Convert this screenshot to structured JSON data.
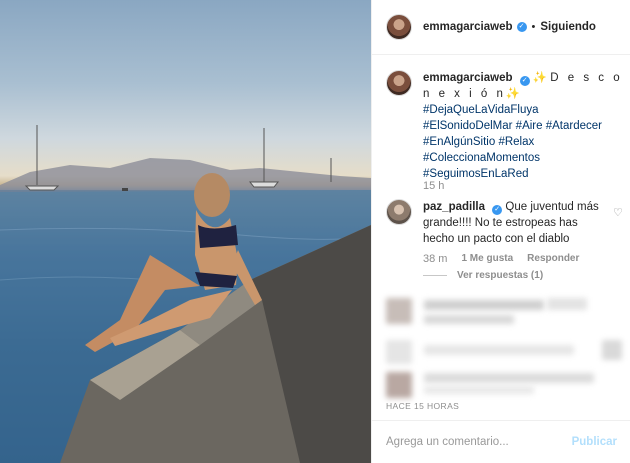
{
  "post": {
    "username": "emmagarciaweb",
    "follow_status": "Siguiendo",
    "separator": "•",
    "caption_desc": "✨D e s c o n e x i ó n✨",
    "hashtags": [
      "#DejaQueLaVidaFluya",
      "#ElSonidoDelMar #Aire #Atardecer",
      "#EnAlgúnSitio #Relax",
      "#ColeccionaMomentos",
      "#SeguimosEnLaRed"
    ],
    "caption_time": "15 h"
  },
  "comment": {
    "username": "paz_padilla",
    "text": "Que juventud más grande!!!! No te estropeas has hecho un pacto con el diablo",
    "time": "38 m",
    "likes": "1 Me gusta",
    "reply": "Responder",
    "view_replies": "Ver respuestas (1)"
  },
  "footer": {
    "posted": "HACE 15 HORAS",
    "comment_placeholder": "Agrega un comentario...",
    "publish": "Publicar"
  },
  "icons": {
    "verified": "verified-badge-icon",
    "heart": "heart-icon"
  },
  "colors": {
    "hashtag": "#003569",
    "verified": "#3897f0",
    "publish_disabled": "#b2dffc",
    "muted": "#8e8e8e"
  }
}
